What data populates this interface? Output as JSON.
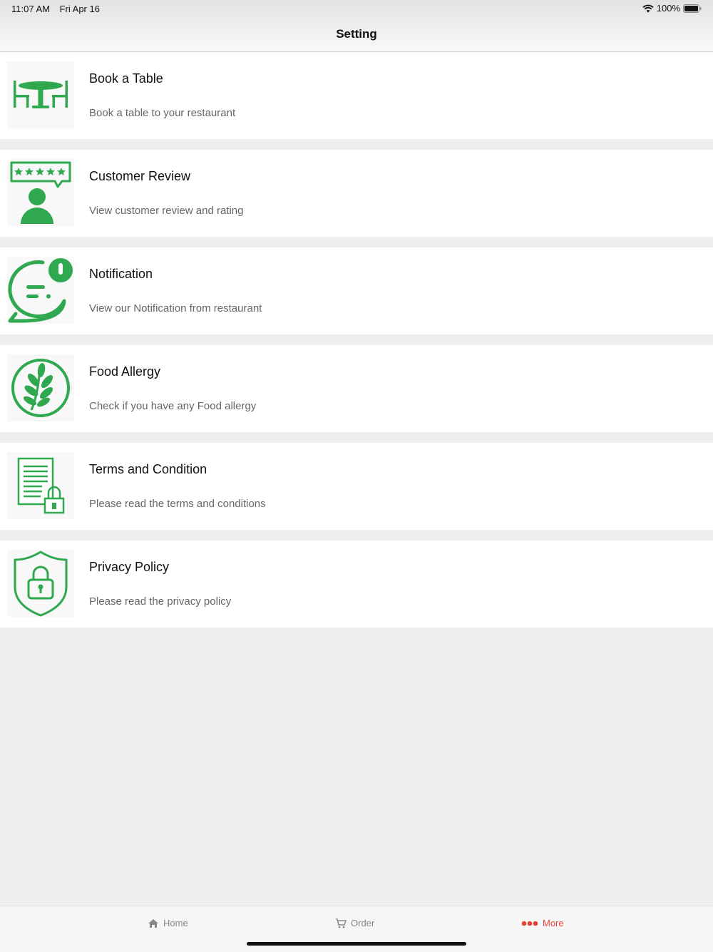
{
  "status_bar": {
    "time": "11:07 AM",
    "date": "Fri Apr 16",
    "battery": "100%"
  },
  "nav": {
    "title": "Setting"
  },
  "items": [
    {
      "title": "Book a Table",
      "subtitle": "Book a table to  your restaurant",
      "icon": "table-icon"
    },
    {
      "title": "Customer Review",
      "subtitle": "View customer review and rating",
      "icon": "review-icon"
    },
    {
      "title": "Notification",
      "subtitle": "View our Notification from restaurant",
      "icon": "notification-icon"
    },
    {
      "title": "Food Allergy",
      "subtitle": "Check if you have any Food allergy",
      "icon": "wheat-icon"
    },
    {
      "title": "Terms and Condition",
      "subtitle": "Please read the terms and conditions",
      "icon": "document-lock-icon"
    },
    {
      "title": "Privacy Policy",
      "subtitle": "Please read the privacy policy",
      "icon": "shield-lock-icon"
    }
  ],
  "tabs": [
    {
      "label": "Home",
      "icon": "home-icon"
    },
    {
      "label": "Order",
      "icon": "cart-icon"
    },
    {
      "label": "More",
      "icon": "more-icon",
      "active": true
    }
  ],
  "colors": {
    "accent_green": "#2fa84f",
    "active_tab": "#e8443a",
    "background": "#efefef"
  }
}
